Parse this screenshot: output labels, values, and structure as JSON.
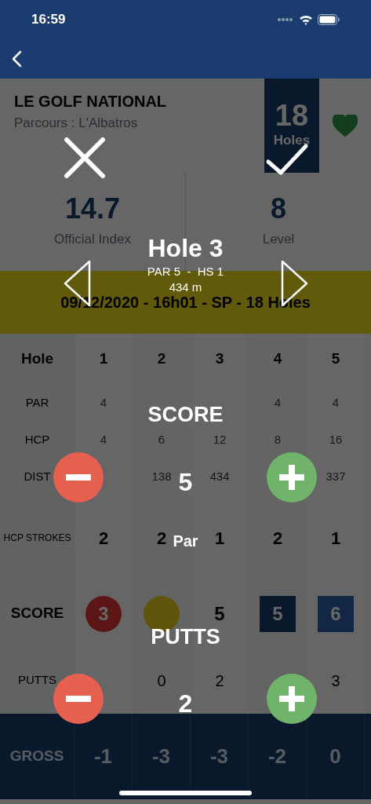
{
  "status_bar": {
    "time": "16:59"
  },
  "course": {
    "name": "LE GOLF NATIONAL",
    "subtitle": "Parcours : L'Albatros",
    "holes_count": "18",
    "holes_label": "Holes",
    "favorite": true
  },
  "stats": [
    {
      "value": "14.7",
      "label": "Official Index"
    },
    {
      "value": "8",
      "label": "Level"
    }
  ],
  "round_info": "09/12/2020 - 16h01 - SP - 18 Holes",
  "scorecard": {
    "rows": [
      {
        "label": "Hole",
        "kind": "header",
        "cells": [
          {
            "text": "1"
          },
          {
            "text": "2"
          },
          {
            "text": "3"
          },
          {
            "text": "4"
          },
          {
            "text": "5"
          }
        ]
      },
      {
        "label": "PAR",
        "kind": "info",
        "cells": [
          {
            "text": "4"
          },
          {},
          {},
          {
            "text": "4"
          },
          {
            "text": "4"
          }
        ]
      },
      {
        "label": "HCP",
        "kind": "info",
        "cells": [
          {
            "text": "4"
          },
          {
            "text": "6"
          },
          {
            "text": "12"
          },
          {
            "text": "8"
          },
          {
            "text": "16"
          }
        ]
      },
      {
        "label": "DIST",
        "kind": "info",
        "cells": [
          {},
          {
            "text": "138"
          },
          {
            "text": "434"
          },
          {},
          {
            "text": "337"
          }
        ]
      },
      {
        "label": "HCP STROKES",
        "kind": "strokes",
        "cells": [
          {
            "text": "2"
          },
          {
            "text": "2"
          },
          {
            "text": "1"
          },
          {
            "text": "2"
          },
          {
            "text": "1"
          }
        ]
      },
      {
        "label": "SCORE",
        "kind": "score",
        "cells": [
          {
            "text": "3",
            "kind": "birdie"
          },
          {
            "kind": "eagle"
          },
          {
            "text": "5",
            "kind": "par"
          },
          {
            "text": "5",
            "kind": "bogey"
          },
          {
            "text": "6",
            "kind": "double_bogey"
          }
        ]
      },
      {
        "label": "PUTTS",
        "kind": "putts",
        "cells": [
          {},
          {
            "text": "0"
          },
          {
            "text": "2"
          },
          {},
          {
            "text": "3"
          }
        ]
      },
      {
        "label": "GROSS",
        "kind": "total",
        "cells": [
          {
            "text": "-1"
          },
          {
            "text": "-3"
          },
          {
            "text": "-3"
          },
          {
            "text": "-2"
          },
          {
            "text": "0"
          }
        ]
      }
    ]
  },
  "modal": {
    "hole_title": "Hole 3",
    "hole_info": "PAR 5  -  HS 1",
    "distance": "434 m",
    "score": {
      "label": "SCORE",
      "value": "5",
      "result": "Par"
    },
    "putts": {
      "label": "PUTTS",
      "value": "2"
    }
  }
}
